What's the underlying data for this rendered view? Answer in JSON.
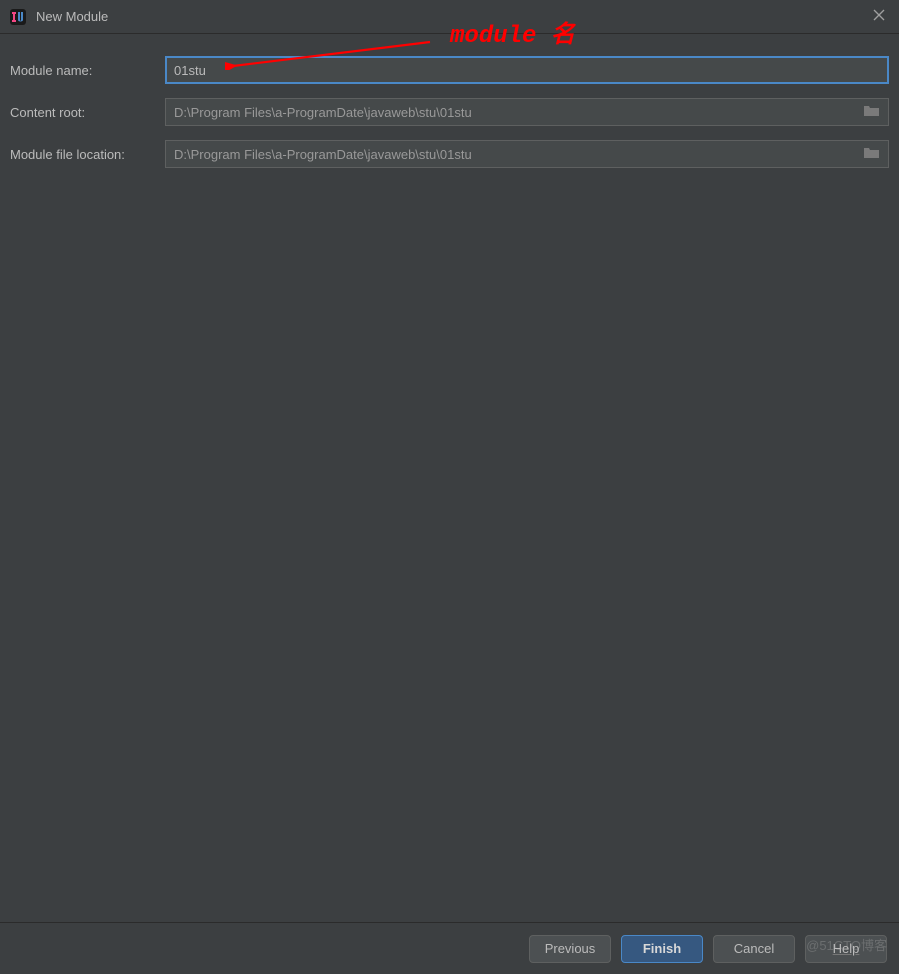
{
  "window": {
    "title": "New Module"
  },
  "annotation": {
    "label": "module 名"
  },
  "form": {
    "module_name_label": "Module name:",
    "module_name_value": "01stu",
    "content_root_label": "Content root:",
    "content_root_value": "D:\\Program Files\\a-ProgramDate\\javaweb\\stu\\01stu",
    "module_file_location_label": "Module file location:",
    "module_file_location_value": "D:\\Program Files\\a-ProgramDate\\javaweb\\stu\\01stu"
  },
  "buttons": {
    "previous": "Previous",
    "finish": "Finish",
    "cancel": "Cancel",
    "help": "Help"
  },
  "watermark": "@51CTO博客"
}
